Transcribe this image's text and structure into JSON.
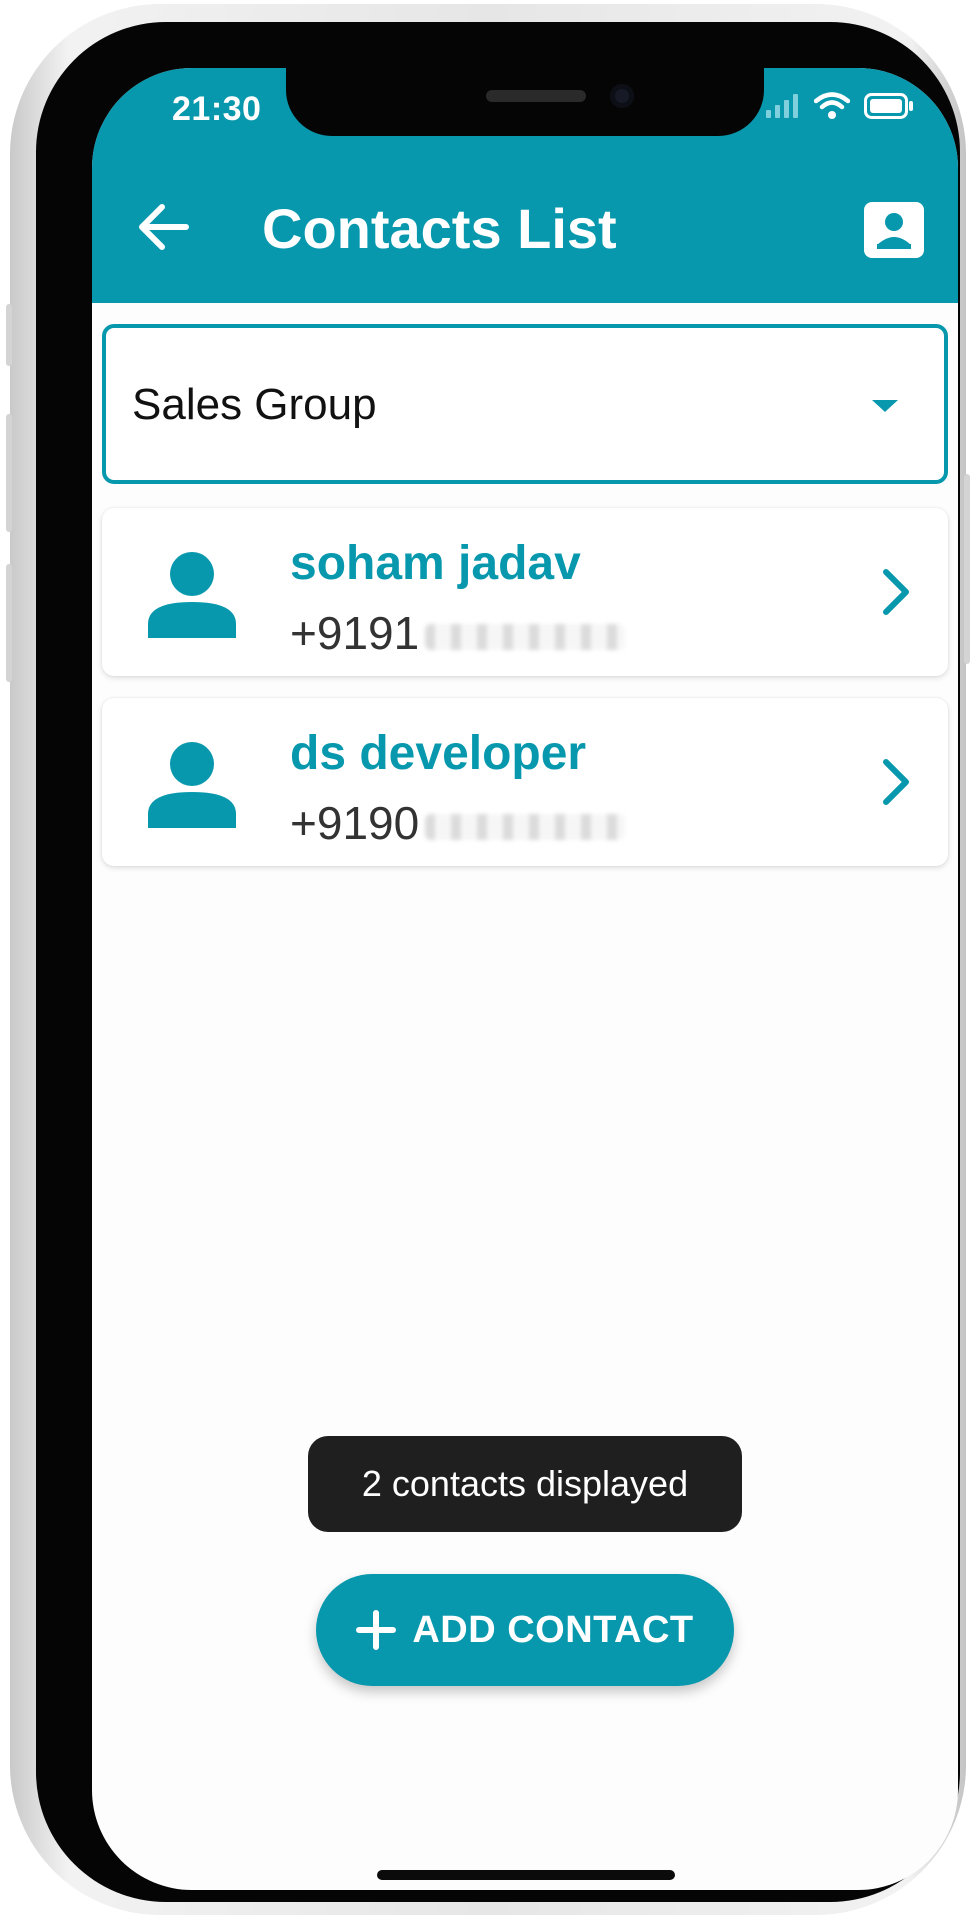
{
  "status_bar": {
    "time": "21:30",
    "icons": [
      "cellular-signal-icon",
      "wifi-icon",
      "battery-icon"
    ]
  },
  "app_bar": {
    "title": "Contacts List",
    "back_icon": "arrow-left-icon",
    "action_icon": "contact-card-icon"
  },
  "group_select": {
    "selected": "Sales Group",
    "icon": "caret-down-icon"
  },
  "contacts": [
    {
      "name": "soham jadav",
      "phone_prefix": "+9191",
      "avatar_icon": "person-icon",
      "chevron_icon": "chevron-right-icon"
    },
    {
      "name": "ds developer",
      "phone_prefix": "+9190",
      "avatar_icon": "person-icon",
      "chevron_icon": "chevron-right-icon"
    }
  ],
  "toast": {
    "text": "2 contacts displayed"
  },
  "add_button": {
    "label": "ADD CONTACT",
    "icon": "plus-icon"
  },
  "colors": {
    "accent": "#0898ad",
    "toast_bg": "#1f1f1f",
    "screen_bg": "#fdfdfd"
  }
}
